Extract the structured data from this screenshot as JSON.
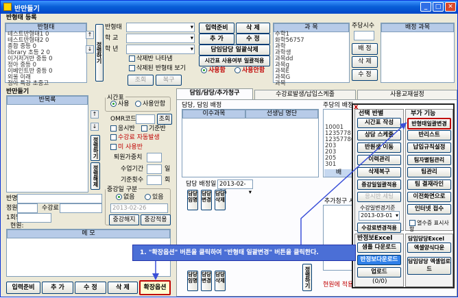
{
  "app": {
    "title": "반만들기"
  },
  "section1": {
    "title": "반형태 등록",
    "list_header": "반형태",
    "list_items": [
      "테스트반형태1 0",
      "테스트반형태2 0",
      "종합 중등 0",
      "library 초등 2 0",
      "이거저거반 중등 0",
      "정아 중등 0",
      "이베인트반 중등 0",
      "외울 이래",
      "정아 특강 초중고"
    ],
    "labels": {
      "name": "반형태",
      "school": "학 교",
      "grade": "학 년"
    },
    "checks": [
      "삭제반 나타냄",
      "삭제된 반형태 보기"
    ],
    "btns": {
      "lookup": "조회",
      "restore": "복구",
      "sort": "정렬하기"
    }
  },
  "topbtns": {
    "input_prep": "입력준비",
    "delete": "삭 제",
    "add": "추 가",
    "edit": "수 정",
    "bulk_del": "담임담당 일괄삭제",
    "time_usage": "시간표 사용여부 일괄적용",
    "use": "사용함",
    "unuse": "사용안함"
  },
  "subject": {
    "header": "과 목",
    "items": [
      "수학1",
      "화학56757",
      "과학",
      "과학생",
      "과목dd",
      "과목g",
      "과목E",
      "과목G",
      "과목"
    ],
    "weekly": "주당시수",
    "btns": [
      "배 정",
      "삭 제",
      "수 정"
    ],
    "assign_header": "배정 과목"
  },
  "section2": {
    "title": "반만들기",
    "list_header": "반목록",
    "timetable_label": "시간표",
    "use": "사용",
    "unuse": "사용안함",
    "omr": "OMR코드",
    "lookup": "조회",
    "checks": [
      "응시반",
      "기준반",
      "수강료 자동발생",
      "미 사용반"
    ],
    "fields": [
      "퇴원가중치",
      "수업기간",
      "기준횟수"
    ],
    "units": [
      "일",
      "회"
    ],
    "interim": "중강일 구분",
    "interim_opts": [
      "없음",
      "있음"
    ],
    "date": "2013-02-26",
    "btn_interim_stop": "중강해지",
    "btn_interim_apply": "중강적용",
    "fields2": [
      "반명",
      "정원",
      "1회당",
      "현원:"
    ],
    "fee": "수강료",
    "sort": "정렬하기",
    "reset": "정렬해제"
  },
  "memo": {
    "header": "메 모"
  },
  "bottombtns": [
    "입력준비",
    "추 가",
    "수 정",
    "삭 제",
    "확장옵션"
  ],
  "tabs": [
    "담임/담당/추가청구",
    "수강료발생/납입스케줄",
    "사용교재설정"
  ],
  "tab1": {
    "label": "담당, 담임 배정",
    "col1": "이수과목",
    "col2": "선생님 명단",
    "weekly_label": "주당의 배정",
    "weekly_nums": [
      "10001",
      "1235778",
      "123577866",
      "203",
      "203",
      "205",
      "301"
    ],
    "assign_date_label": "담당 배정일",
    "assign_date": "2013-02-26",
    "vbtns": [
      "담당임명",
      "담당변경",
      "담당삭제"
    ],
    "extra_label": "추가청구 시",
    "red_text": "현원에 적용"
  },
  "popup": {
    "h1": "선택 반별",
    "h2": "부가 기능",
    "left": [
      "시간표 작성",
      "상담 스케줄",
      "반원생 이동",
      "이력관리",
      "삭제복구",
      "중강일일괄적용",
      "응시반 세팅",
      "수강일변경기준"
    ],
    "date": "2013-03-01",
    "left2": "수강료변경적용",
    "right": [
      "반형태일괄변경",
      "반리스트",
      "납입규칙설정",
      "팀자별팀관리",
      "팀관리",
      "팀 결재라인",
      "이전화면으로",
      "인터넷 접수"
    ],
    "check": "열수증 표시사항",
    "h3": "반정보Excel",
    "h4": "담임담당Excel",
    "excel_btns": [
      "샘플 다운로드",
      "반정보다운로드",
      "업로드",
      "(0/0)"
    ],
    "excel_right": [
      "엑셀양식다운",
      "담임담당 엑셀업로드"
    ]
  },
  "callout": {
    "text": "1. \"확장옵션\" 버튼을 클릭하여 \"반형태 일괄변경\" 버튼을 클릭한다."
  },
  "colors": {
    "accent": "#0046c8",
    "highlight": "#cc0000",
    "callout": "#4b6fd6"
  }
}
